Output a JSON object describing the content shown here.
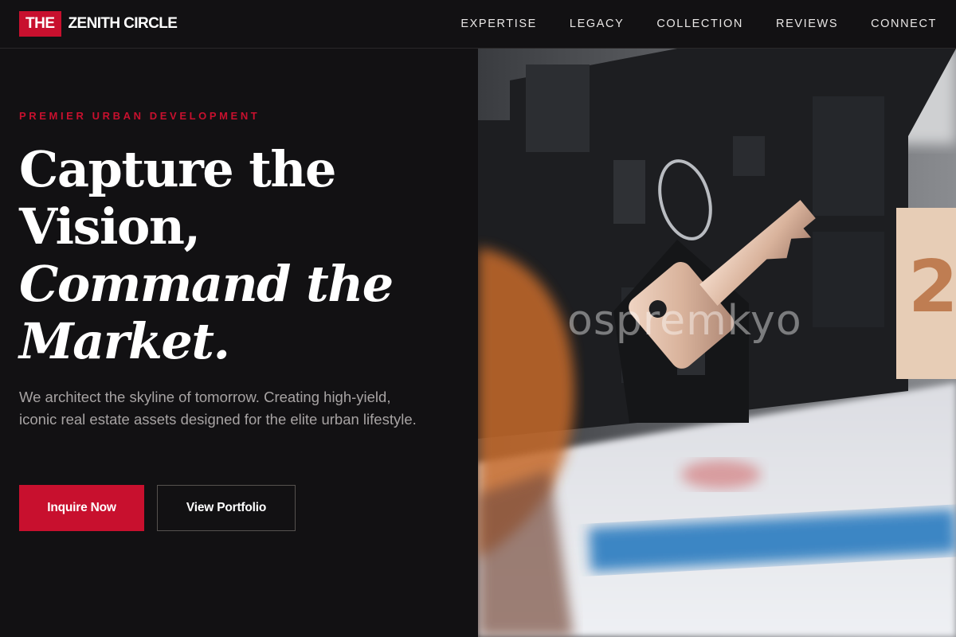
{
  "brand": {
    "mark": "THE",
    "name": "ZENITH CIRCLE",
    "accent_color": "#c8102e",
    "background_color": "#121113"
  },
  "nav": {
    "items": [
      {
        "label": "EXPERTISE"
      },
      {
        "label": "LEGACY"
      },
      {
        "label": "COLLECTION"
      },
      {
        "label": "REVIEWS"
      },
      {
        "label": "CONNECT"
      }
    ]
  },
  "hero": {
    "eyebrow": "PREMIER URBAN DEVELOPMENT",
    "headline_line1": "Capture the",
    "headline_line2": "Vision,",
    "headline_line3": "Command the",
    "headline_line4": "Market.",
    "subcopy": "We architect the skyline of tomorrow. Creating high-yield, iconic real estate assets designed for the elite urban lifestyle.",
    "primary_button": "Inquire Now",
    "secondary_button": "View Portfolio"
  },
  "image": {
    "subject": "house-key-on-model-house-photo",
    "watermark": "ospremkyo"
  }
}
